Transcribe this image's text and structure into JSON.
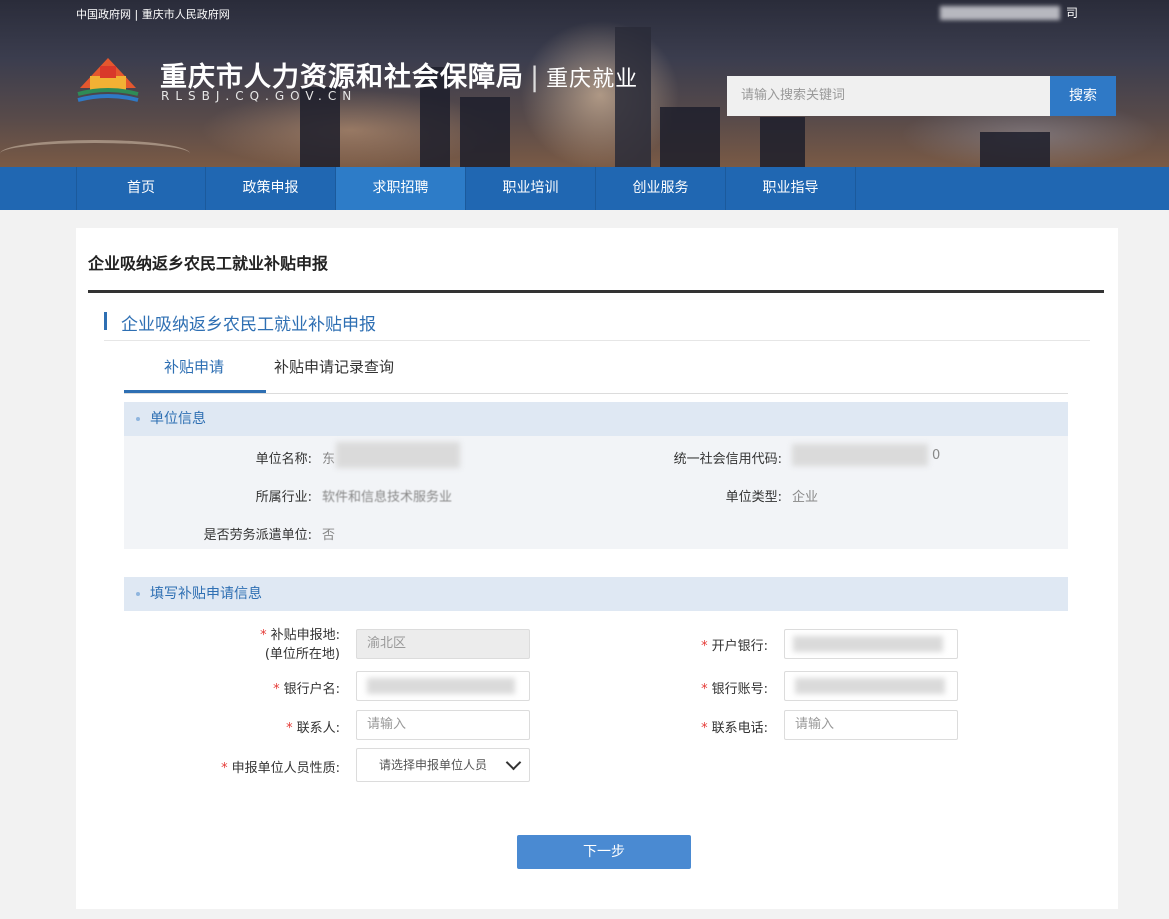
{
  "header": {
    "top_links": "中国政府网 | 重庆市人民政府网",
    "top_right_tail": "司",
    "site_title": "重庆市人力资源和社会保障局",
    "site_subtitle": "重庆就业",
    "site_domain": "RLSBJ.CQ.GOV.CN",
    "search_placeholder": "请输入搜索关键词",
    "search_button": "搜索"
  },
  "nav": {
    "items": [
      "首页",
      "政策申报",
      "求职招聘",
      "职业培训",
      "创业服务",
      "职业指导"
    ],
    "active_index": 2
  },
  "page": {
    "title": "企业吸纳返乡农民工就业补贴申报",
    "section_title": "企业吸纳返乡农民工就业补贴申报",
    "tabs": [
      "补贴申请",
      "补贴申请记录查询"
    ],
    "active_tab": 0
  },
  "unit_info": {
    "heading": "单位信息",
    "unit_name_label": "单位名称:",
    "unit_name_value": "东",
    "credit_code_label": "统一社会信用代码:",
    "credit_code_value": "0",
    "industry_label": "所属行业:",
    "industry_value": "软件和信息技术服务业",
    "unit_type_label": "单位类型:",
    "unit_type_value": "企业",
    "dispatch_label": "是否劳务派遣单位:",
    "dispatch_value": "否"
  },
  "form": {
    "heading": "填写补贴申请信息",
    "required_mark": "*",
    "location_label": "补贴申报地:",
    "location_label_sub": "(单位所在地)",
    "location_value": "渝北区",
    "bank_label": "开户银行:",
    "account_name_label": "银行户名:",
    "account_number_label": "银行账号:",
    "contact_label": "联系人:",
    "contact_placeholder": "请输入",
    "phone_label": "联系电话:",
    "phone_placeholder": "请输入",
    "personnel_label": "申报单位人员性质:",
    "personnel_placeholder": "请选择申报单位人员"
  },
  "actions": {
    "next_button": "下一步"
  }
}
